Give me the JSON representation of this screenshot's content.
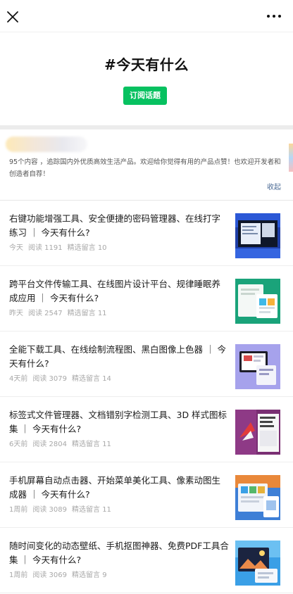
{
  "topbar": {
    "close_icon": "close-icon",
    "more_icon": "more-icon"
  },
  "header": {
    "title": "#今天有什么",
    "subscribe_label": "订阅话题",
    "accent_color": "#07c160"
  },
  "intro": {
    "text": "95个内容 ，追踪国内外优质高效生活产品。欢迎给你觉得有用的产品点赞！也欢迎开发者和创造者自荐！",
    "collapse_label": "收起"
  },
  "articles": [
    {
      "title": "右键功能增强工具、安全便捷的密码管理器、在线打字练习 ｜ 今天有什么?",
      "date": "今天",
      "reads": "阅读 1191",
      "comments": "精选留言 10"
    },
    {
      "title": "跨平台文件传输工具、在线图片设计平台、规律睡眠养成应用 ｜ 今天有什么?",
      "date": "昨天",
      "reads": "阅读 2547",
      "comments": "精选留言 11"
    },
    {
      "title": "全能下载工具、在线绘制流程图、黑白图像上色器 ｜ 今天有什么?",
      "date": "4天前",
      "reads": "阅读 3079",
      "comments": "精选留言 14"
    },
    {
      "title": "标签式文件管理器、文档错别字检测工具、3D 样式图标集 ｜ 今天有什么?",
      "date": "6天前",
      "reads": "阅读 2804",
      "comments": "精选留言 11"
    },
    {
      "title": "手机屏幕自动点击器、开始菜单美化工具、像素动图生成器 ｜ 今天有什么?",
      "date": "1周前",
      "reads": "阅读 3089",
      "comments": "精选留言 11"
    },
    {
      "title": "随时间变化的动态壁纸、手机抠图神器、免费PDF工具合集 ｜ 今天有什么?",
      "date": "1周前",
      "reads": "阅读 3069",
      "comments": "精选留言 9"
    }
  ]
}
